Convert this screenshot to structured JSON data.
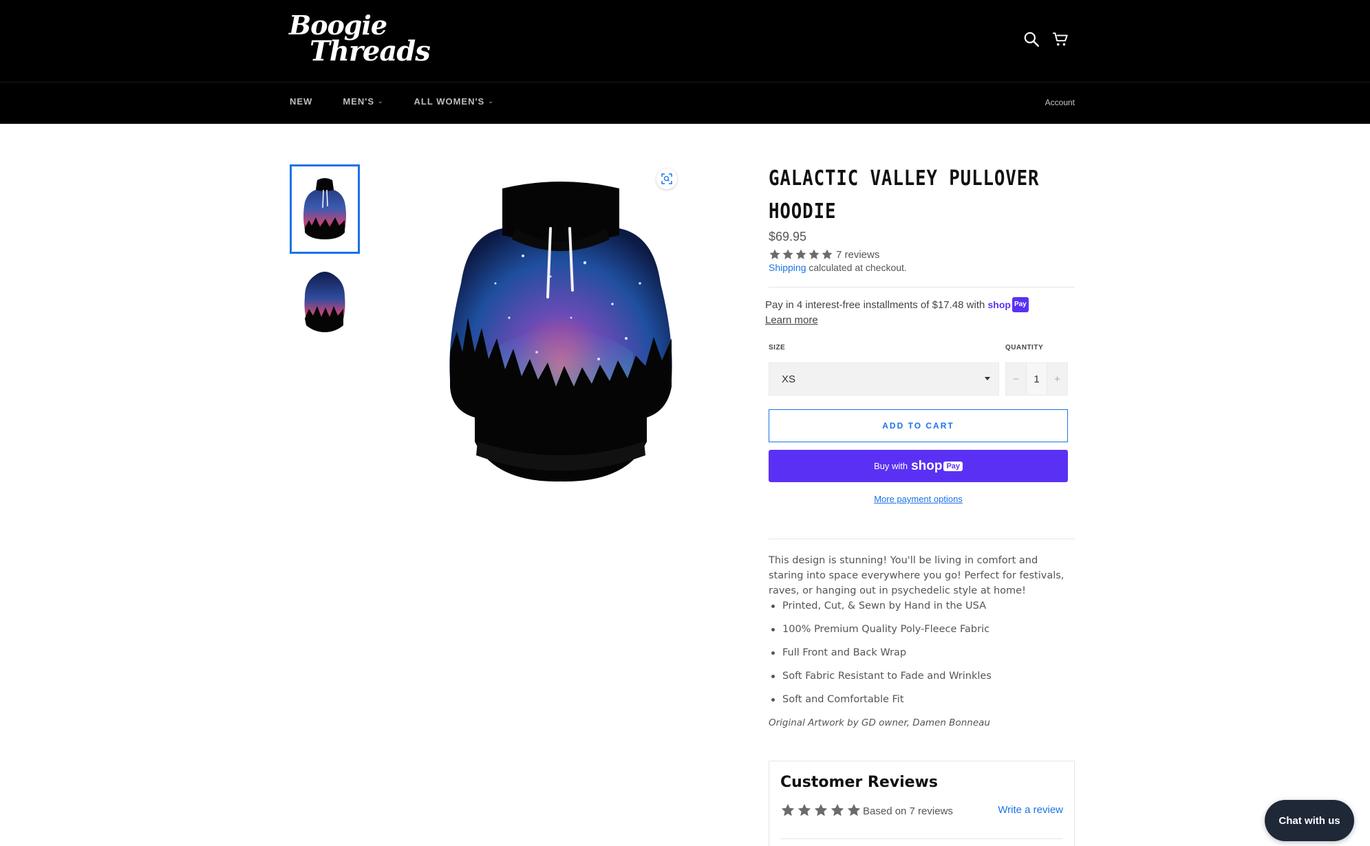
{
  "header": {
    "logo_line1": "Boogie",
    "logo_line2": "Threads",
    "search_icon": "search-icon",
    "cart_icon": "cart-icon",
    "nav": [
      {
        "label": "NEW",
        "has_dropdown": false
      },
      {
        "label": "MEN'S",
        "has_dropdown": true
      },
      {
        "label": "ALL WOMEN'S",
        "has_dropdown": true
      }
    ],
    "account_label": "Account"
  },
  "gallery": {
    "thumbnails": [
      "front",
      "back"
    ],
    "active_index": 0,
    "zoom_icon": "zoom-icon"
  },
  "product": {
    "title_line1": "GALACTIC VALLEY PULLOVER",
    "title_line2": "HOODIE",
    "price": "$69.95",
    "rating": 5,
    "reviews_label": "7 reviews",
    "shipping_link": "Shipping",
    "shipping_text": " calculated at checkout.",
    "installments_text": "Pay in 4 interest-free installments of $17.48 with ",
    "shoppay_word": "shop",
    "shoppay_pay": "Pay",
    "learn_more": "Learn more",
    "size_label": "SIZE",
    "size_value": "XS",
    "quantity_label": "QUANTITY",
    "quantity_value": "1",
    "minus": "−",
    "plus": "+",
    "add_to_cart": "ADD TO CART",
    "buy_with": "Buy with",
    "buy_shop": "shop",
    "buy_pay": "Pay",
    "more_payment": "More payment options"
  },
  "description": {
    "intro": "This design is stunning! You'll be living in comfort and staring into space everywhere you go! Perfect for festivals, raves, or hanging out in psychedelic style at home!",
    "bullets": [
      "Printed, Cut, & Sewn by Hand in the USA",
      "100% Premium Quality Poly-Fleece Fabric",
      "Full Front and Back Wrap",
      "Soft Fabric Resistant to Fade and Wrinkles",
      "Soft and Comfortable Fit"
    ],
    "credit": "Original Artwork by GD owner, Damen Bonneau"
  },
  "reviews": {
    "title": "Customer Reviews",
    "rating": 5,
    "based_on": "Based on 7 reviews",
    "write_review": "Write a review"
  },
  "chat": {
    "label": "Chat with us"
  },
  "colors": {
    "accent": "#1a73e8",
    "shoppay": "#5a31f4",
    "header_bg": "#000000",
    "chat_bg": "#1f2837"
  }
}
